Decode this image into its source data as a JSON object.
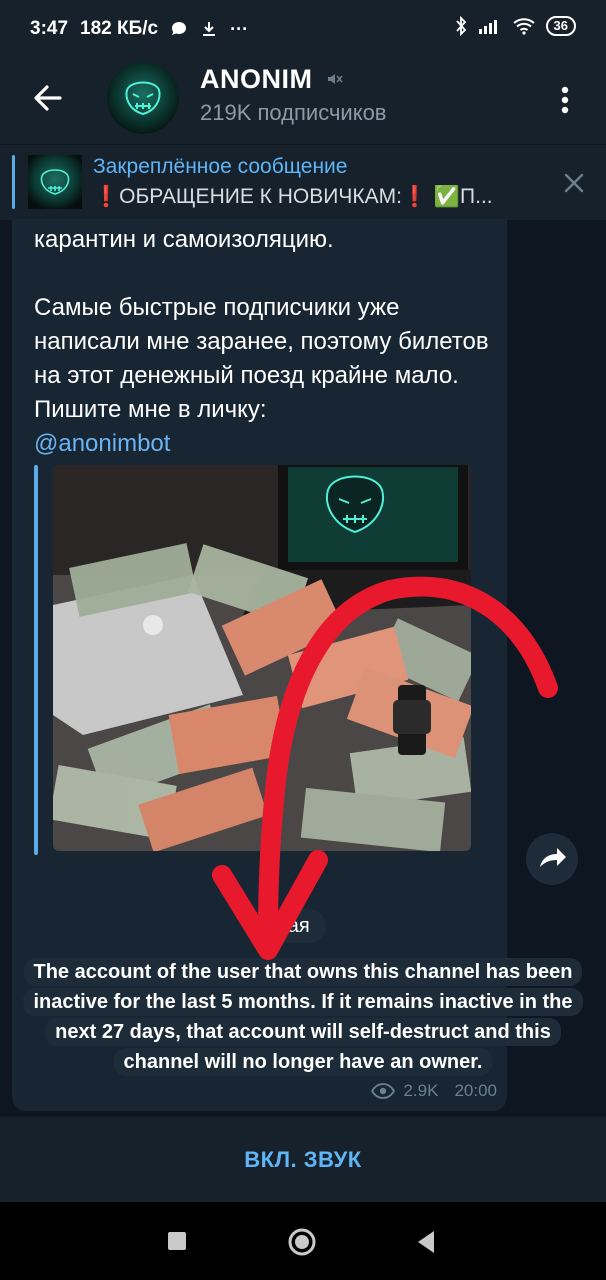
{
  "status_bar": {
    "time": "3:47",
    "speed": "182 КБ/с",
    "battery": "36"
  },
  "header": {
    "title": "ANONIM",
    "subscribers": "219K подписчиков"
  },
  "pinned": {
    "title": "Закреплённое сообщение",
    "text": "❗ОБРАЩЕНИЕ К НОВИЧКАМ:❗ ✅П..."
  },
  "message": {
    "lines_top": "карантин и самоизоляцию.",
    "paragraph": "Самые быстрые подписчики уже написали мне заранее, поэтому билетов на этот денежный поезд крайне мало. Пишите мне в личку:",
    "link": "@anonimbot",
    "views": "2.9K",
    "time": "20:00"
  },
  "date_pill": "мая",
  "service_message": "The account of the user that owns this channel has been inactive for the last 5 months. If it remains inactive in the next 27 days, that account will self-destruct and this channel will no longer have an owner.",
  "bottom_button": "ВКЛ. ЗВУК",
  "colors": {
    "background": "#0e1621",
    "panel": "#17212b",
    "bubble": "#182533",
    "accent": "#5eb5f7",
    "annotation_arrow": "#e8192c"
  }
}
